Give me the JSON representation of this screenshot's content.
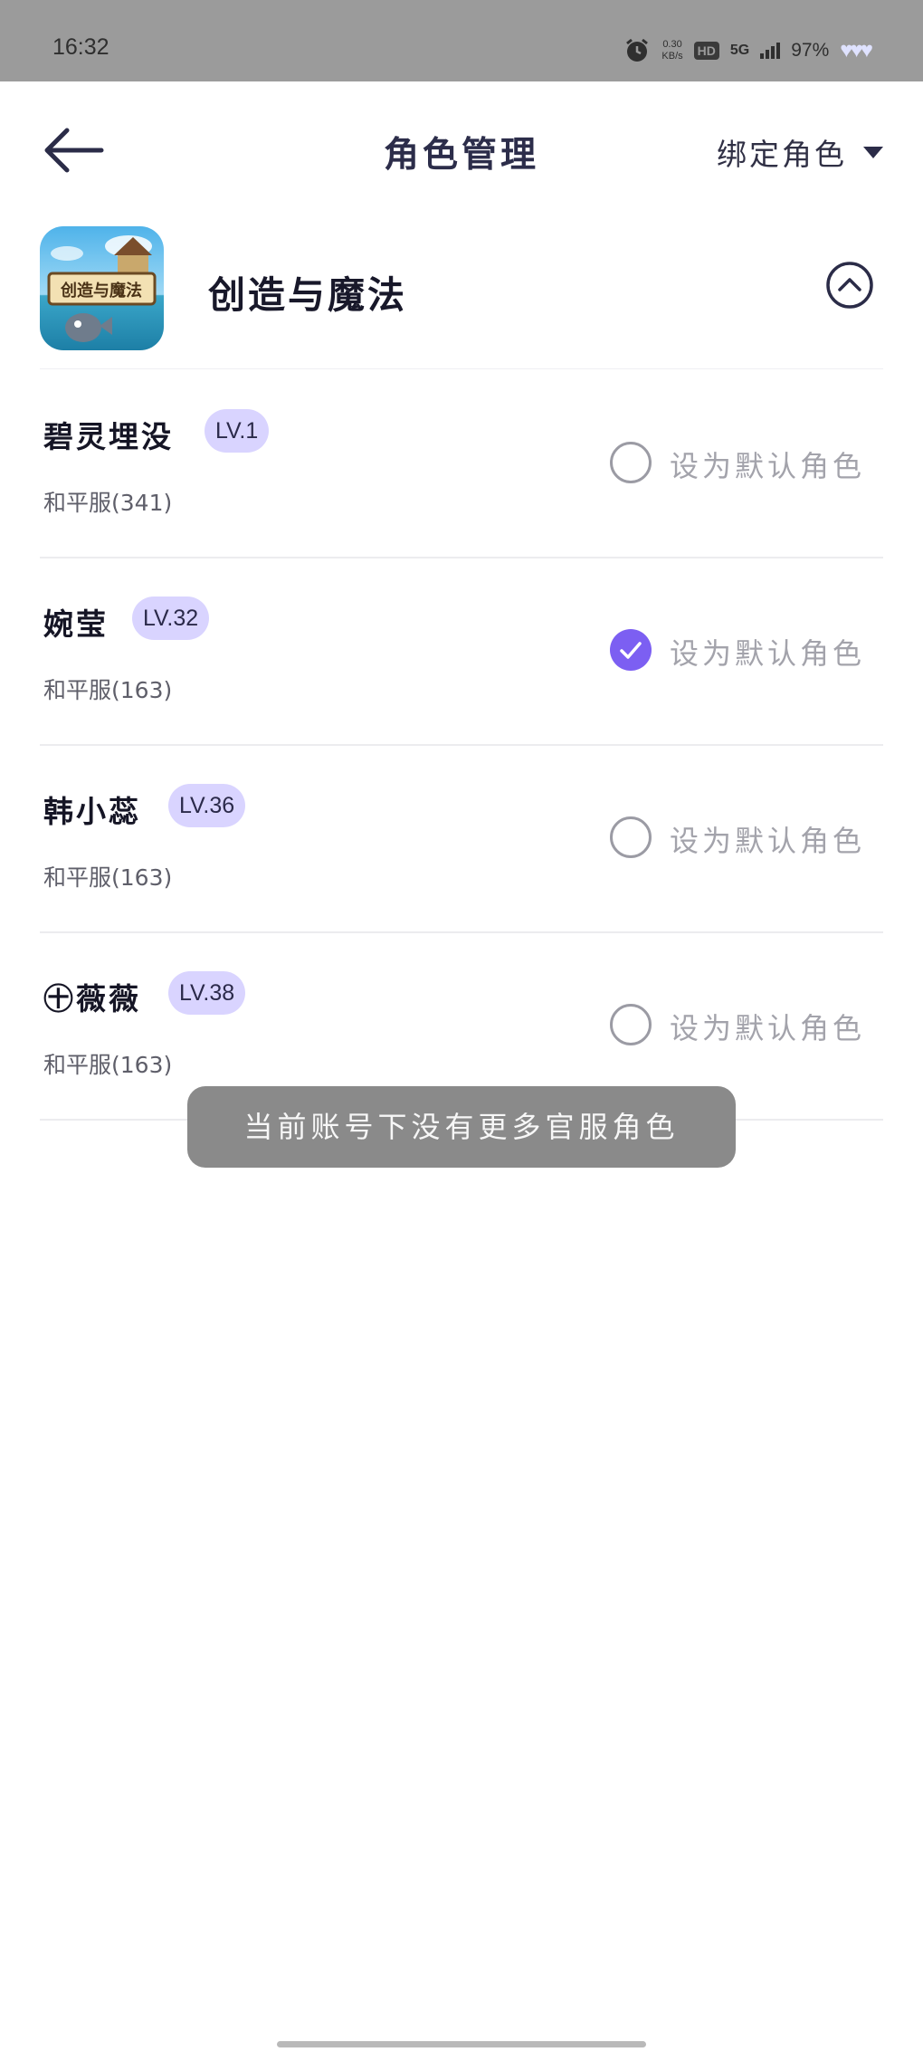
{
  "status_bar": {
    "time": "16:32",
    "speed_value": "0.30",
    "speed_unit": "KB/s",
    "hd": "HD",
    "network": "5G",
    "battery": "97%",
    "icons": [
      "alarm-icon",
      "signal-icon",
      "hearts-icon"
    ]
  },
  "header": {
    "title": "角色管理",
    "bind_label": "绑定角色",
    "back_icon": "arrow-left-icon",
    "caret_icon": "caret-down-icon"
  },
  "game": {
    "name": "创造与魔法",
    "icon_text": "创造与魔法",
    "collapse_icon": "chevron-up-circle-icon"
  },
  "roles": [
    {
      "name": "碧灵埋没",
      "level": "LV.1",
      "server": "和平服(341)",
      "default_label": "设为默认角色",
      "is_default": false
    },
    {
      "name": "婉莹",
      "level": "LV.32",
      "server": "和平服(163)",
      "default_label": "设为默认角色",
      "is_default": true
    },
    {
      "name": "韩小蕊",
      "level": "LV.36",
      "server": "和平服(163)",
      "default_label": "设为默认角色",
      "is_default": false
    },
    {
      "name": "㊉薇薇",
      "level": "LV.38",
      "server": "和平服(163)",
      "default_label": "设为默认角色",
      "is_default": false
    }
  ],
  "toast": {
    "message": "当前账号下没有更多官服角色"
  },
  "colors": {
    "accent": "#7c5ff2",
    "badge_bg": "#d9d4ff",
    "status_bar": "#9b9b9b",
    "toast_bg": "#8a8a8a"
  }
}
